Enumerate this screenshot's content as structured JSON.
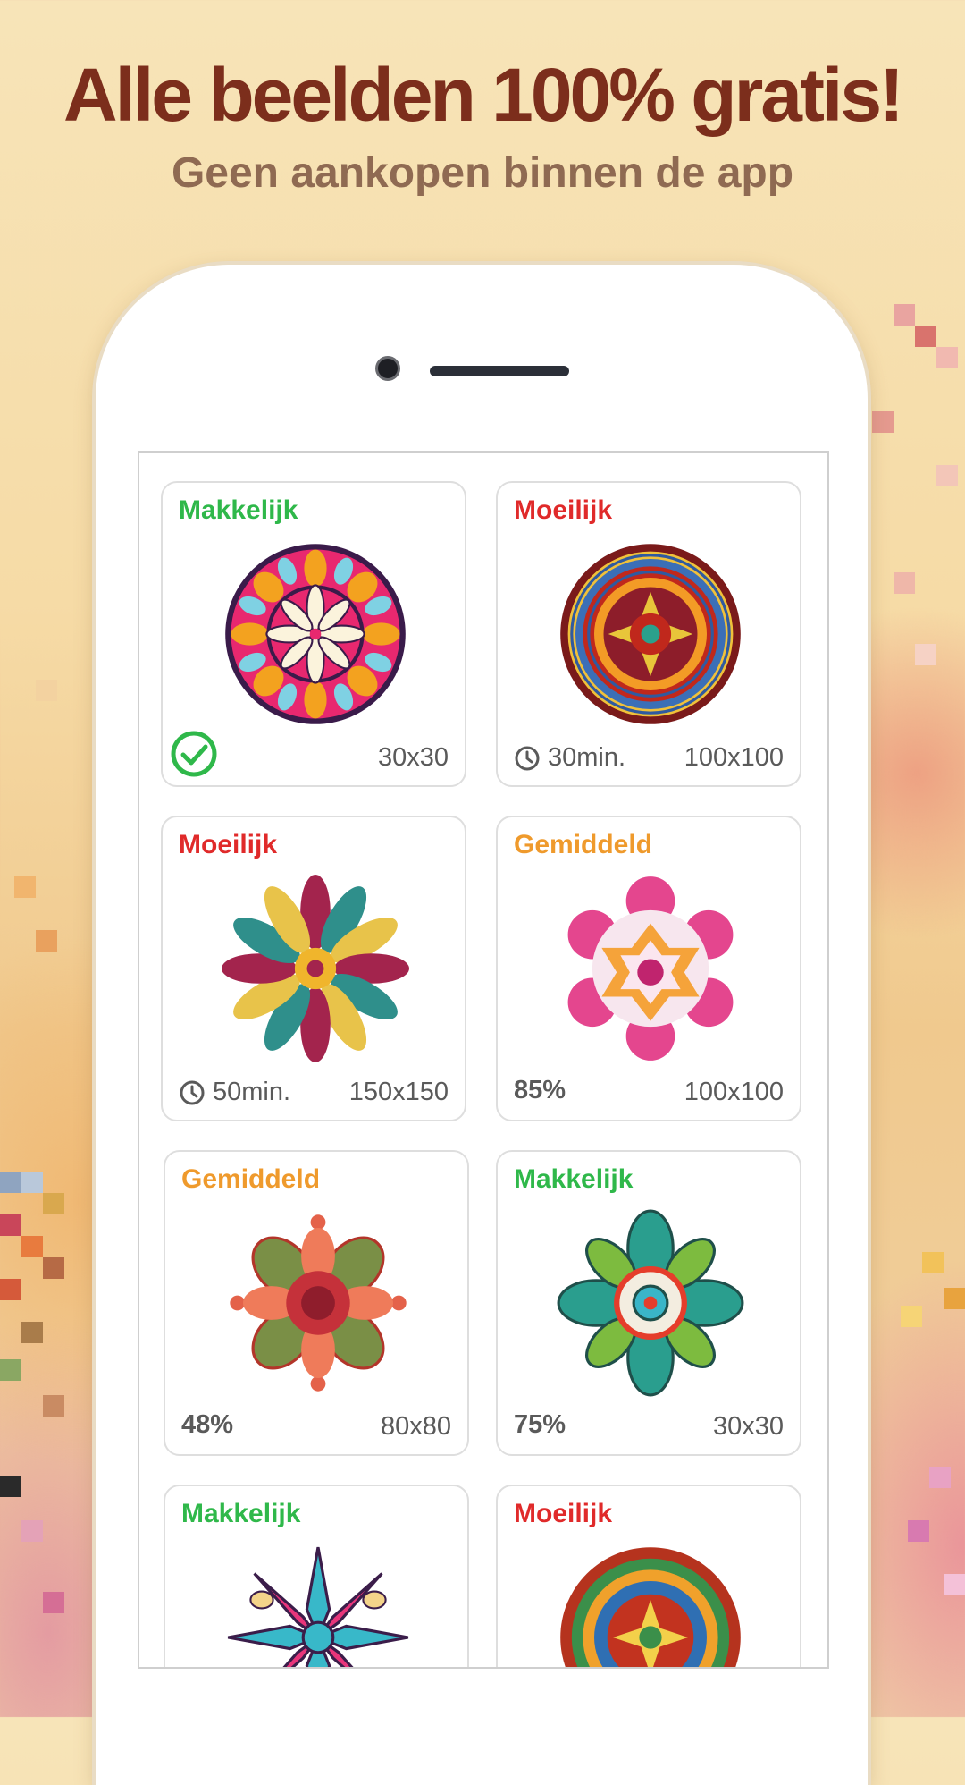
{
  "headline": "Alle beelden 100% gratis!",
  "subline": "Geen aankopen binnen de app",
  "cards": [
    {
      "difficulty": "Makkelijk",
      "level": "easy",
      "size": "30x30",
      "completed": true,
      "time": "",
      "progress": ""
    },
    {
      "difficulty": "Moeilijk",
      "level": "hard",
      "size": "100x100",
      "completed": false,
      "time": "30min.",
      "progress": ""
    },
    {
      "difficulty": "Moeilijk",
      "level": "hard",
      "size": "150x150",
      "completed": false,
      "time": "50min.",
      "progress": ""
    },
    {
      "difficulty": "Gemiddeld",
      "level": "mid",
      "size": "100x100",
      "completed": false,
      "time": "",
      "progress": "85%"
    },
    {
      "difficulty": "Gemiddeld",
      "level": "mid",
      "size": "80x80",
      "completed": false,
      "time": "",
      "progress": "48%"
    },
    {
      "difficulty": "Makkelijk",
      "level": "easy",
      "size": "30x30",
      "completed": false,
      "time": "",
      "progress": "75%"
    },
    {
      "difficulty": "Makkelijk",
      "level": "easy",
      "size": "",
      "completed": false,
      "time": "",
      "progress": ""
    },
    {
      "difficulty": "Moeilijk",
      "level": "hard",
      "size": "",
      "completed": false,
      "time": "",
      "progress": ""
    }
  ],
  "icons": {
    "completed": "check-circle-icon",
    "time": "clock-icon",
    "artwork": "mandala-thumbnail"
  },
  "colors": {
    "headline": "#7c2e1c",
    "subline": "#8f6a52",
    "easy": "#2fb84a",
    "hard": "#e02a2a",
    "medium": "#ef9a2c"
  }
}
